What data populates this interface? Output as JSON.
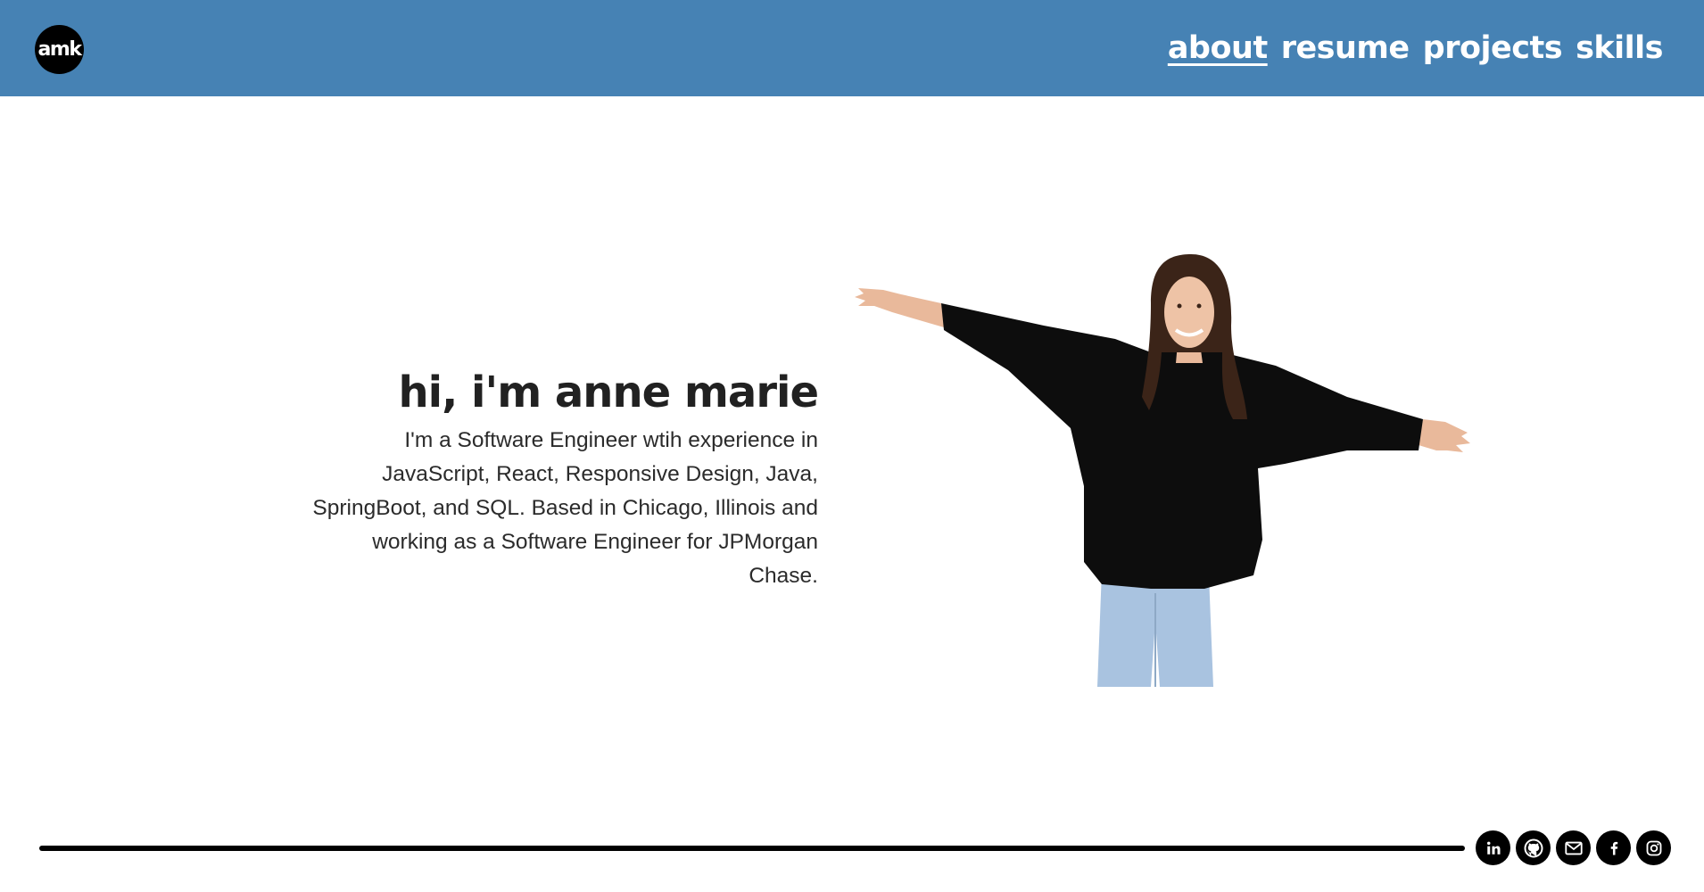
{
  "header": {
    "logo_text": "amk",
    "nav": [
      {
        "label": "about",
        "active": true
      },
      {
        "label": "resume",
        "active": false
      },
      {
        "label": "projects",
        "active": false
      },
      {
        "label": "skills",
        "active": false
      }
    ]
  },
  "intro": {
    "heading": "hi, i'm anne marie",
    "body": "I'm a Software Engineer wtih experience in JavaScript, React, Responsive Design, Java, SpringBoot, and SQL. Based in Chicago, Illinois and working as a Software Engineer for JPMorgan Chase."
  },
  "footer": {
    "socials": [
      {
        "name": "linkedin-icon"
      },
      {
        "name": "github-icon"
      },
      {
        "name": "email-icon"
      },
      {
        "name": "facebook-icon"
      },
      {
        "name": "instagram-icon"
      }
    ]
  },
  "colors": {
    "header_bg": "#4682b4",
    "text_dark": "#212121",
    "icon_bg": "#000000"
  }
}
